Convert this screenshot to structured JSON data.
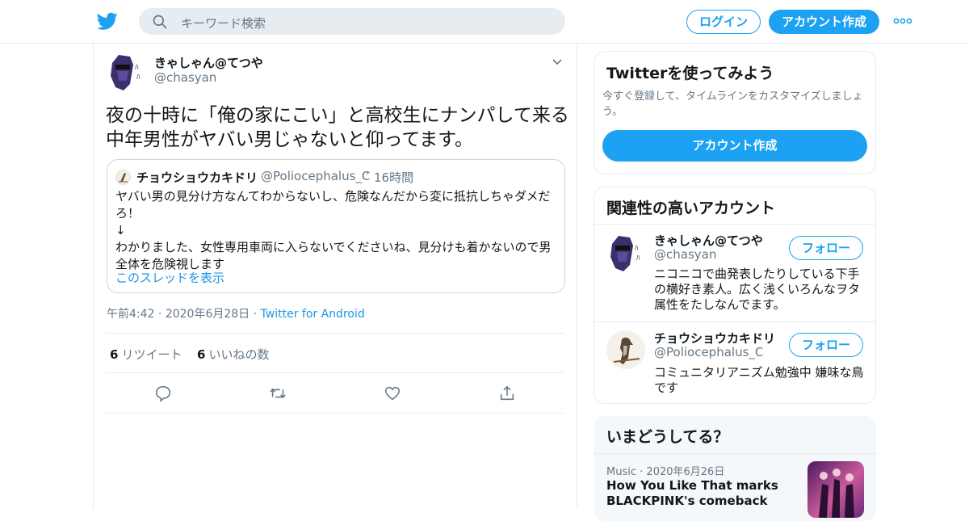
{
  "header": {
    "search_placeholder": "キーワード検索",
    "login_label": "ログイン",
    "signup_label": "アカウント作成"
  },
  "tweet": {
    "author_name": "きゃしゃん@てつや",
    "author_handle": "@chasyan",
    "text": "夜の十時に「俺の家にこい」と高校生にナンパして来る中年男性がヤバい男じゃないと仰ってます。",
    "quoted": {
      "author_name": "チョウショウカキドリ",
      "author_handle": "@Poliocephalus_C",
      "separator": "·",
      "time": "16時間",
      "line1": "ヤバい男の見分け方なんてわからないし、危険なんだから変に抵抗しちゃダメだろ！",
      "line2": "↓",
      "line3": "わかりました、女性専用車両に入らないでくださいね、見分けも着かないので男全体を危険視します",
      "thread_link": "このスレッドを表示"
    },
    "time": "午前4:42",
    "date": "2020年6月28日",
    "separator": "·",
    "source": "Twitter for Android",
    "retweets_count": "6",
    "retweets_label": "リツイート",
    "likes_count": "6",
    "likes_label": "いいねの数"
  },
  "signup_card": {
    "title": "Twitterを使ってみよう",
    "description": "今すぐ登録して、タイムラインをカスタマイズしましょう。",
    "button": "アカウント作成"
  },
  "related": {
    "title": "関連性の高いアカウント",
    "accounts": [
      {
        "name": "きゃしゃん@てつや",
        "handle": "@chasyan",
        "bio": "ニコニコで曲発表したりしている下手の横好き素人。広く浅くいろんなヲタ属性をたしなんでます。",
        "follow": "フォロー"
      },
      {
        "name": "チョウショウカキドリ",
        "handle": "@Poliocephalus_C",
        "bio": "コミュニタリアニズム勉強中 嫌味な鳥です",
        "follow": "フォロー"
      }
    ]
  },
  "trends": {
    "title": "いまどうしてる？",
    "items": [
      {
        "category": "Music",
        "separator": "·",
        "date": "2020年6月26日",
        "headline": "How You Like That marks BLACKPINK's comeback"
      }
    ]
  },
  "colors": {
    "brand": "#1da1f2",
    "link": "#1b95e0",
    "muted": "#657786",
    "border": "#e6ecf0"
  }
}
